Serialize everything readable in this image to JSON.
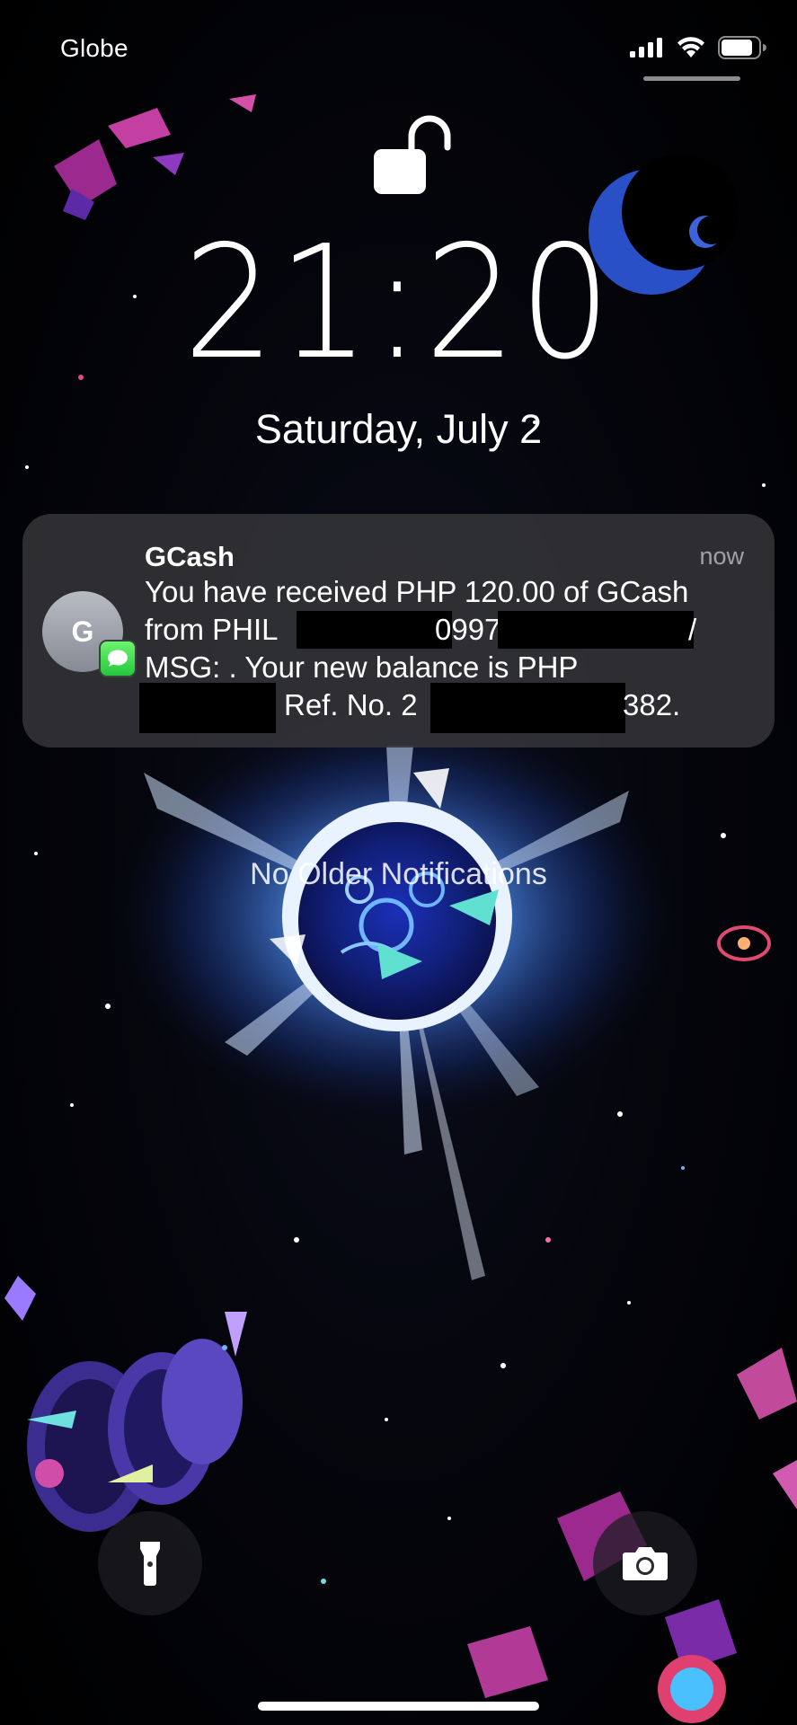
{
  "status_bar": {
    "carrier": "Globe",
    "signal_icon": "cellular-signal-icon",
    "wifi_icon": "wifi-icon",
    "battery_icon": "battery-icon"
  },
  "lock_screen": {
    "lock_icon": "unlocked-padlock-icon",
    "time": "21:20",
    "date": "Saturday, July 2"
  },
  "notification": {
    "app_name": "GCash",
    "timestamp": "now",
    "avatar_initial": "G",
    "badge_icon": "messages-icon",
    "lines": [
      "You have received PHP 120.00 of GCash",
      "from PHIL",
      "0997",
      "/",
      "MSG: . Your new balance is PHP",
      "Ref. No. 2",
      "382."
    ]
  },
  "no_older_notifications": "No Older Notifications",
  "controls": {
    "flashlight_icon": "flashlight-icon",
    "camera_icon": "camera-icon"
  },
  "colors": {
    "notification_bg": "#343438",
    "messages_green": "#30d158",
    "wallpaper_bg": "#000000"
  }
}
